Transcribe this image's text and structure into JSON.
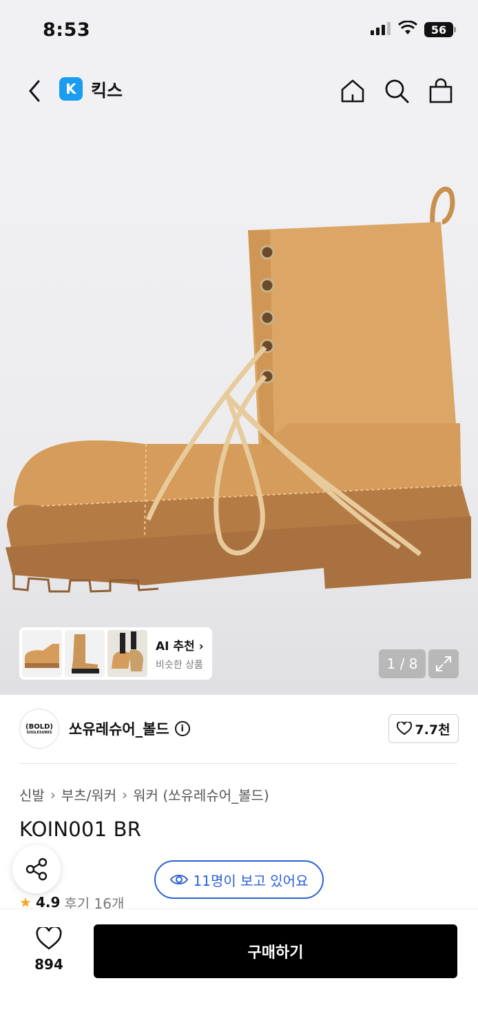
{
  "status_bar": {
    "time": "8:53",
    "battery": "56"
  },
  "header": {
    "brand_letter": "K",
    "brand_name": "킥스"
  },
  "gallery": {
    "counter": "1 / 8",
    "ai_card": {
      "title": "AI 추천",
      "subtitle": "비슷한 상품"
    }
  },
  "seller": {
    "logo_text": "(BOLD)",
    "logo_sub": "SOULESURES",
    "name": "쏘유레슈어_볼드",
    "likes": "7.7천"
  },
  "breadcrumb": [
    "신발",
    "부츠/워커",
    "워커 (쏘유레슈어_볼드)"
  ],
  "product": {
    "title": "KOIN001 BR"
  },
  "viewers": {
    "text": "11명이 보고 있어요"
  },
  "rating": {
    "score": "4.9",
    "reviews": "후기 16개"
  },
  "bottom_bar": {
    "wish_count": "894",
    "buy_label": "구매하기"
  },
  "colors": {
    "accent_blue": "#2a5fd6",
    "brand_blue": "#1a9cf0",
    "boot_tan": "#d9a35f",
    "star": "#f5a623"
  }
}
